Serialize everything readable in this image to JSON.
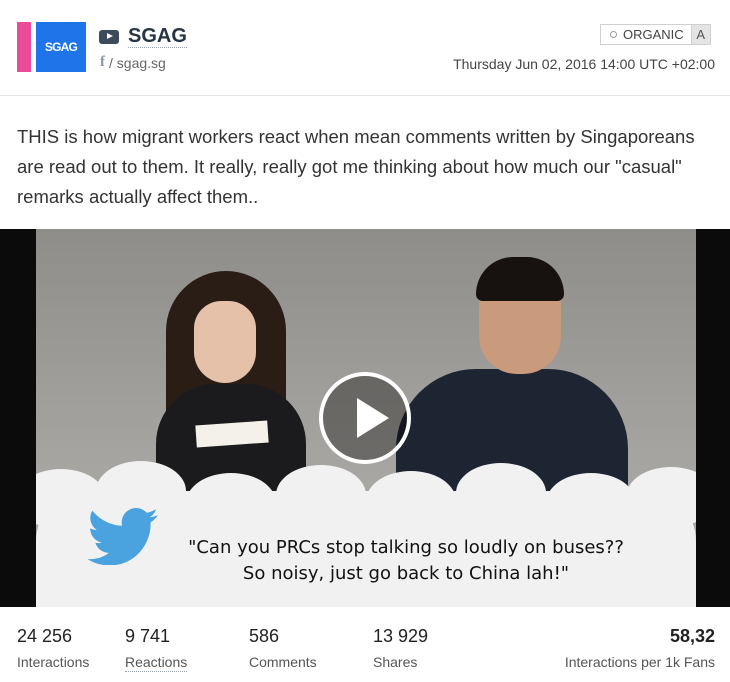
{
  "page": {
    "avatar_text": "SGAG",
    "name": "SGAG",
    "handle": "/ sgag.sg"
  },
  "badge": {
    "label": "ORGANIC",
    "letter": "A"
  },
  "timestamp": "Thursday Jun 02, 2016 14:00 UTC +02:00",
  "post": {
    "text": "THIS is how migrant workers react when mean comments written by Singaporeans are read out to them. It really, really got me thinking about how much our \"casual\" remarks actually affect them.."
  },
  "video": {
    "caption_line1": "\"Can you PRCs stop talking so loudly on buses??",
    "caption_line2": "So noisy, just go back to China lah!\""
  },
  "stats": [
    {
      "value": "24 256",
      "label": "Interactions"
    },
    {
      "value": "9 741",
      "label": "Reactions"
    },
    {
      "value": "586",
      "label": "Comments"
    },
    {
      "value": "13 929",
      "label": "Shares"
    },
    {
      "value": "58,32",
      "label": "Interactions per 1k Fans"
    }
  ],
  "colors": {
    "pink_accent": "#ea4c9a",
    "brand_blue": "#1e74e8",
    "twitter_blue": "#4aa3df"
  },
  "icons": {
    "platform": "youtube-icon",
    "source": "facebook-icon",
    "tag": "tag-icon",
    "play": "play-icon",
    "caption": "twitter-bird-icon"
  }
}
